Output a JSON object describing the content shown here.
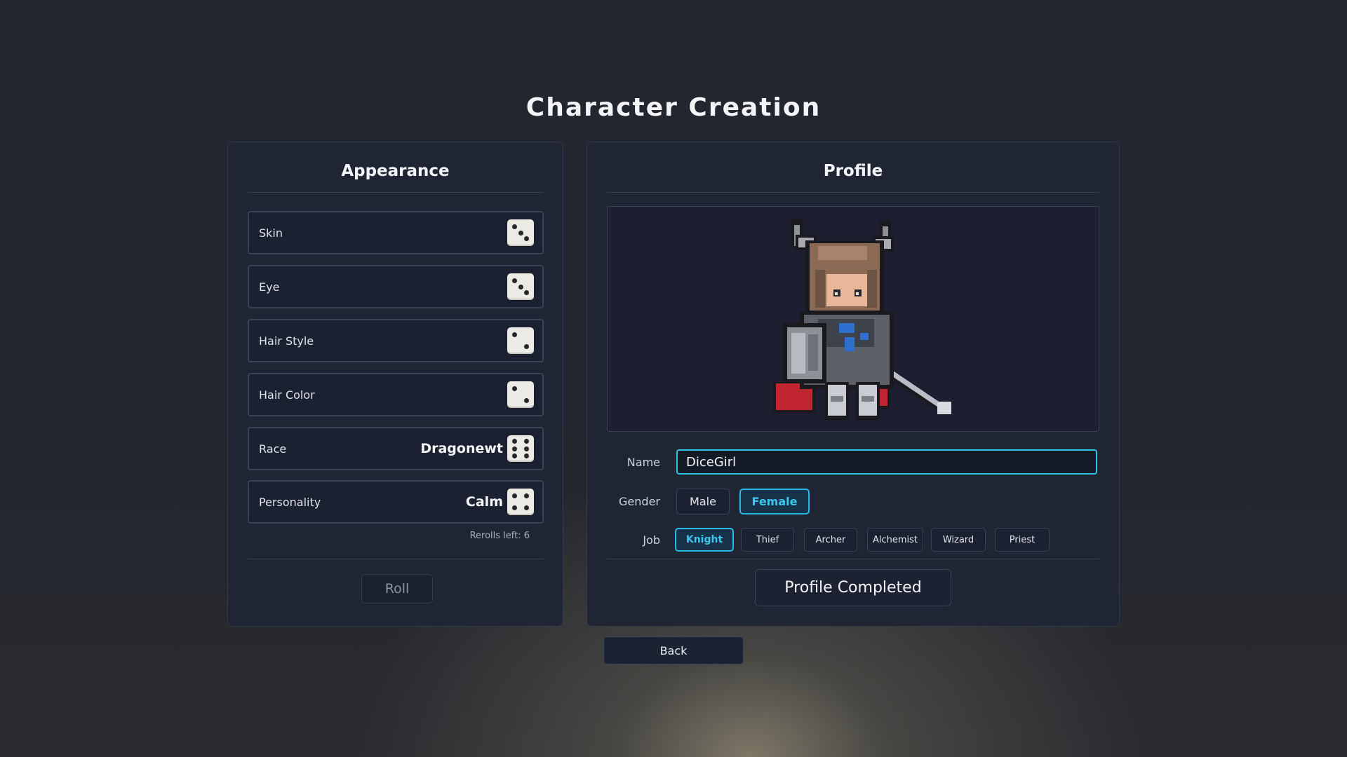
{
  "title": "Character Creation",
  "appearance": {
    "heading": "Appearance",
    "rows": [
      {
        "label": "Skin",
        "value": "",
        "die": 3
      },
      {
        "label": "Eye",
        "value": "",
        "die": 3
      },
      {
        "label": "Hair Style",
        "value": "",
        "die": 2
      },
      {
        "label": "Hair Color",
        "value": "",
        "die": 2
      },
      {
        "label": "Race",
        "value": "Dragonewt",
        "die": 6
      },
      {
        "label": "Personality",
        "value": "Calm",
        "die": 4
      }
    ],
    "rerolls_text": "Rerolls left: 6",
    "roll_label": "Roll"
  },
  "profile": {
    "heading": "Profile",
    "name_label": "Name",
    "name_value": "DiceGirl",
    "gender_label": "Gender",
    "genders": [
      "Male",
      "Female"
    ],
    "selected_gender": "Female",
    "job_label": "Job",
    "jobs": [
      "Knight",
      "Thief",
      "Archer",
      "Alchemist",
      "Wizard",
      "Priest"
    ],
    "selected_job": "Knight",
    "completed_label": "Profile Completed"
  },
  "back_label": "Back",
  "colors": {
    "accent": "#2bb8e4",
    "panel": "#1f2533",
    "die_face": "#eceae4"
  }
}
